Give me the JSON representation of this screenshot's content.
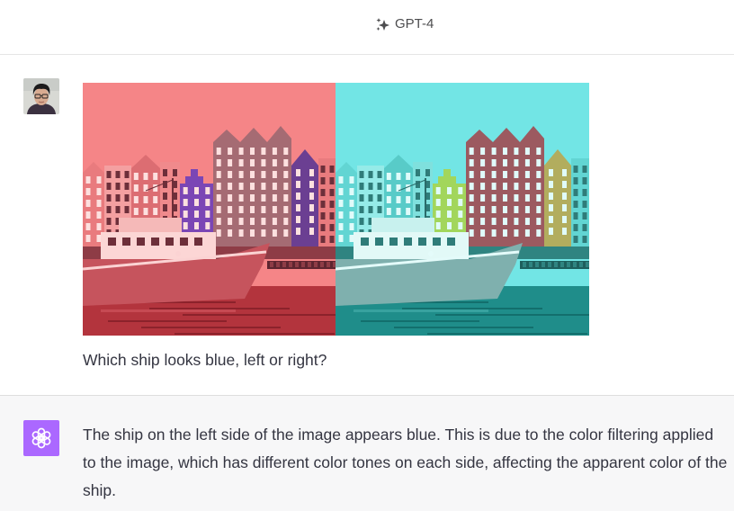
{
  "header": {
    "model_label": "GPT-4",
    "icon": "sparkle-icon",
    "icon_color": "#4d4d4f"
  },
  "conversation": {
    "user_message": {
      "avatar": "user-avatar",
      "image": {
        "left_tint": "#f58587",
        "right_tint": "#72e5e5"
      },
      "text": "Which ship looks blue, left or right?"
    },
    "assistant_message": {
      "icon": "openai-logo-icon",
      "icon_bg": "#ab68ff",
      "text": "The ship on the left side of the image appears blue. This is due to the color filtering applied to the image, which has different color tones on each side, affecting the apparent color of the ship."
    }
  },
  "colors": {
    "background": "#ffffff",
    "assistant_background": "#f7f7f8",
    "text": "#343541",
    "divider": "#e5e5e5"
  }
}
